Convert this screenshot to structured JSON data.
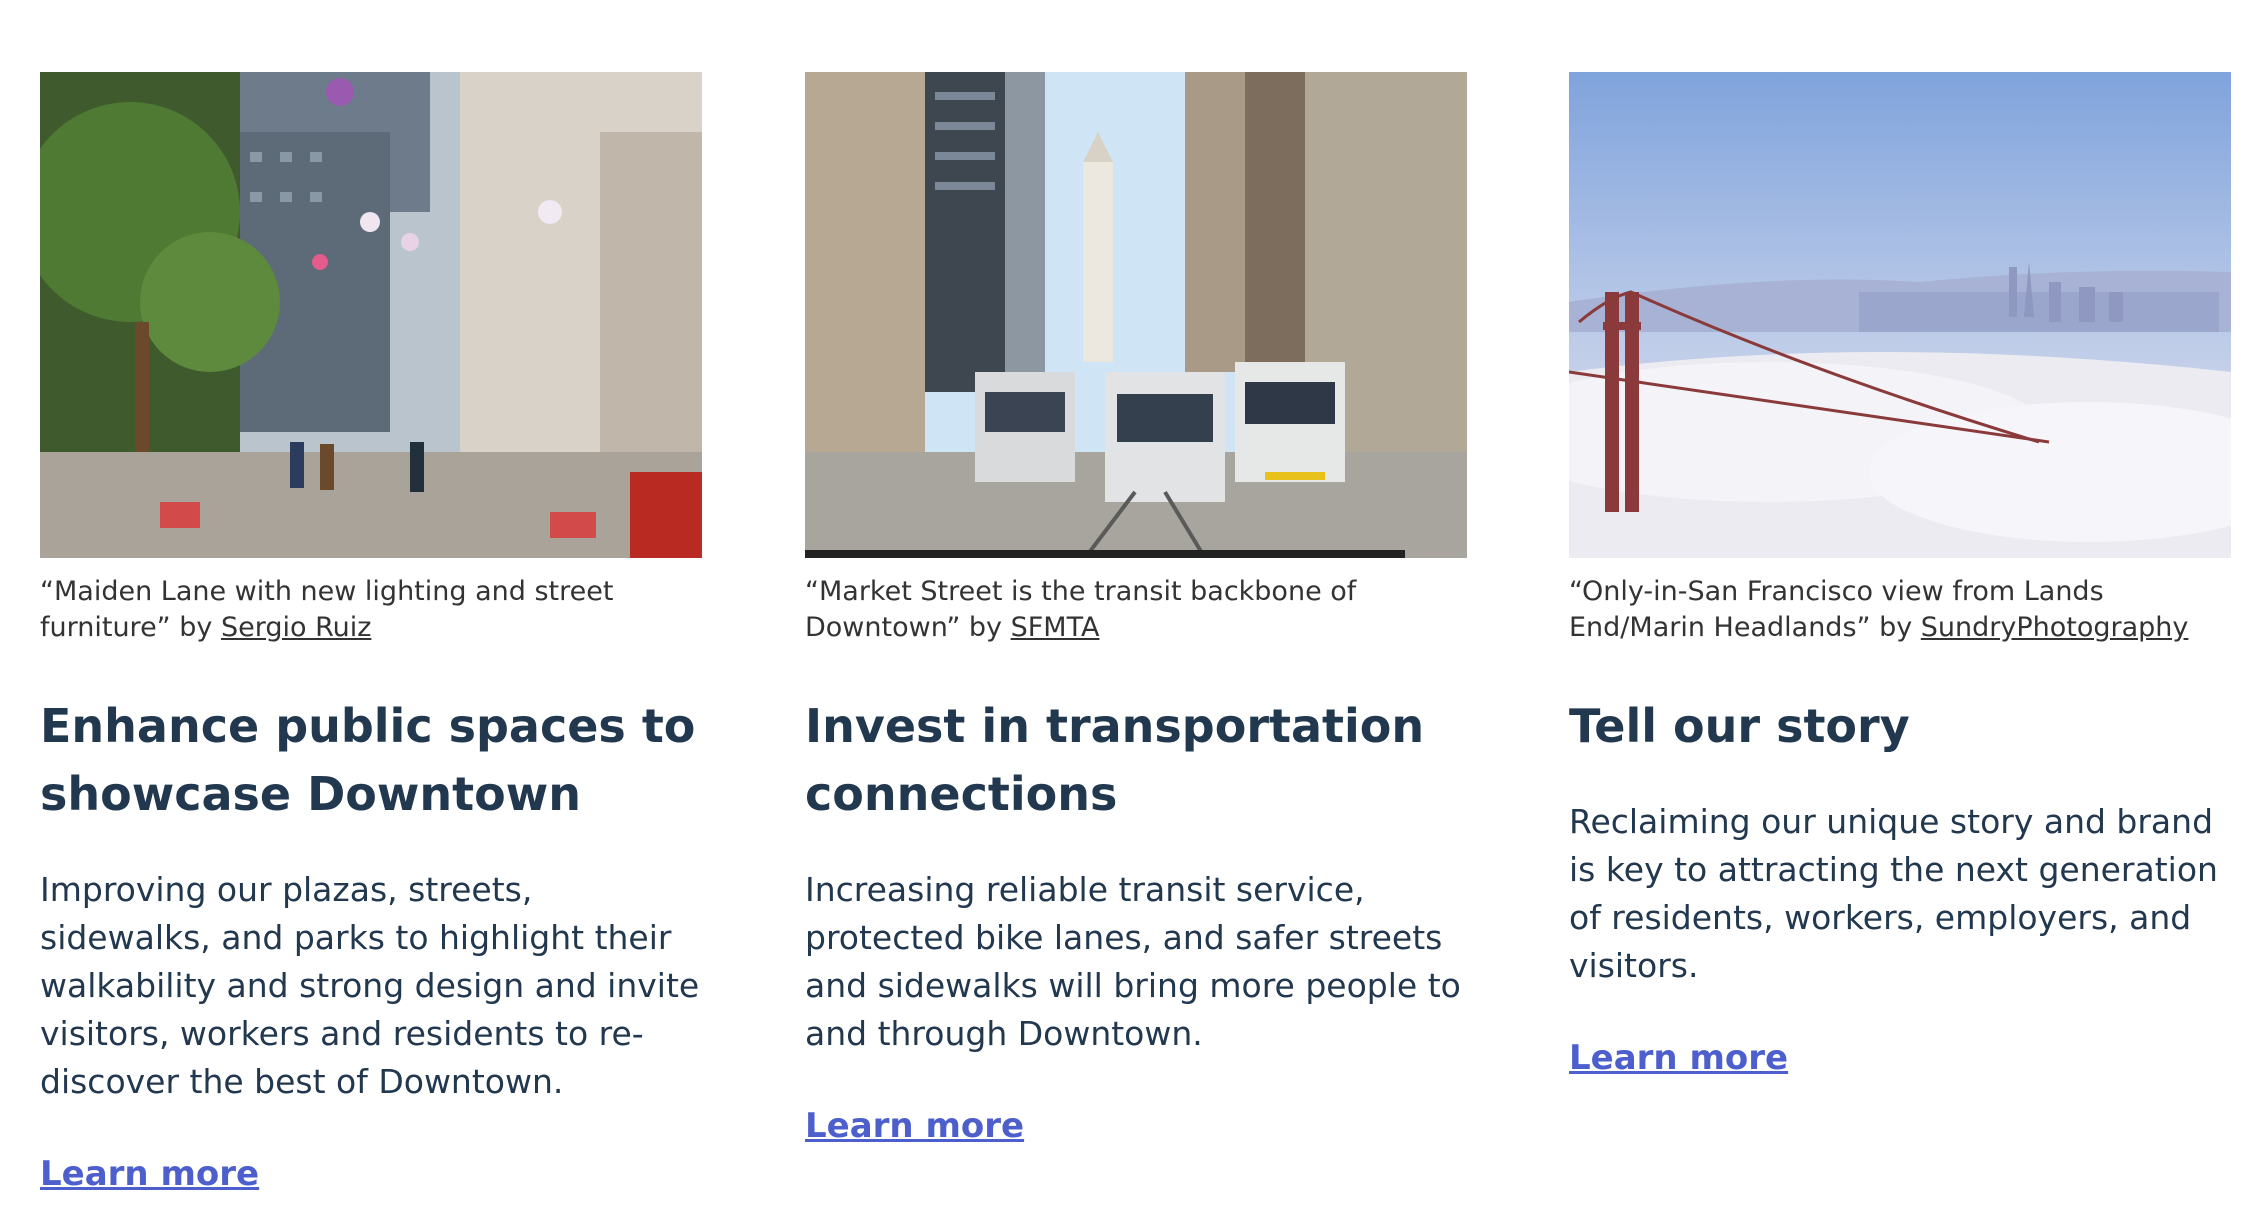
{
  "cards": [
    {
      "caption_text": "“Maiden Lane with new lighting and street furniture” by ",
      "caption_link": "Sergio Ruiz",
      "title": "Enhance public spaces to showcase Downtown",
      "body": "Improving our plazas, streets, sidewalks, and parks to highlight their walkability and strong design and invite visitors, workers and residents to re-discover the best of Downtown.",
      "link": "Learn more",
      "image_icon": "street-photo-icon"
    },
    {
      "caption_text": "“Market Street is the transit backbone of Downtown” by ",
      "caption_link": "SFMTA",
      "title": "Invest in transportation connections",
      "body": "Increasing reliable transit service, protected bike lanes, and safer streets and sidewalks will bring more people to and through Downtown.",
      "link": "Learn more",
      "image_icon": "transit-photo-icon"
    },
    {
      "caption_text": "“Only-in-San Francisco view from Lands End/Marin Headlands” by ",
      "caption_link": "SundryPhotography",
      "title": "Tell our story",
      "body": "Reclaiming our unique story and brand is key to attracting the next generation of residents, workers, employers, and visitors.",
      "link": "Learn more",
      "image_icon": "skyline-photo-icon"
    }
  ],
  "colors": {
    "heading": "#22384f",
    "link": "#4d5fcc",
    "caption": "#333333"
  }
}
